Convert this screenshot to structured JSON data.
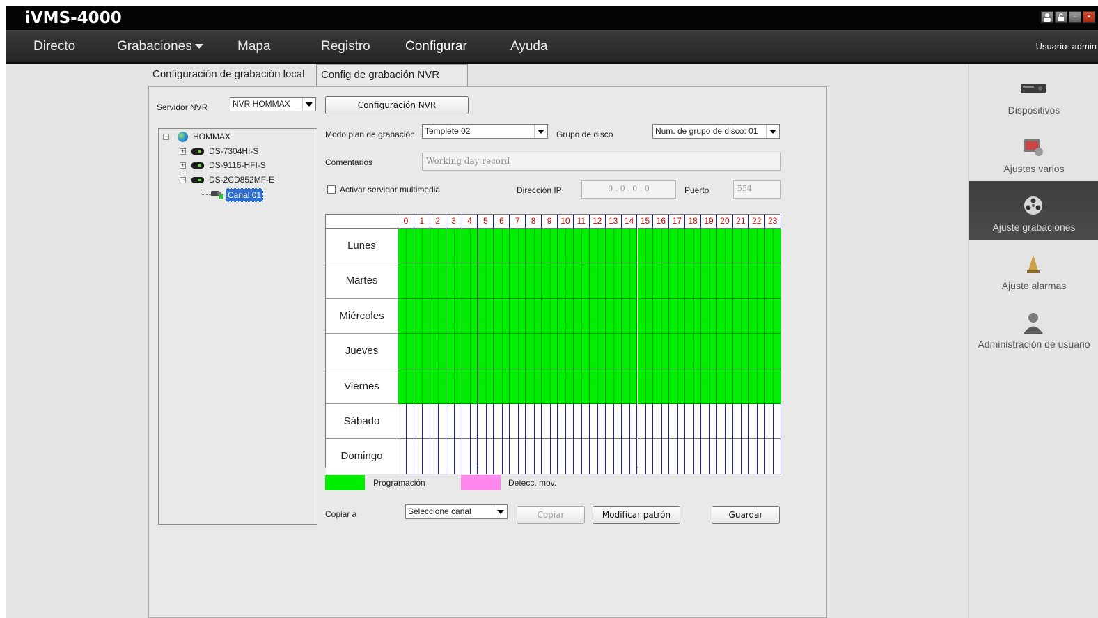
{
  "app": {
    "title": "iVMS-4000",
    "user_label": "Usuario: admin"
  },
  "menu": {
    "items": [
      {
        "label": "Directo"
      },
      {
        "label": "Grabaciones"
      },
      {
        "label": "Mapa"
      },
      {
        "label": "Registro"
      },
      {
        "label": "Configurar"
      },
      {
        "label": "Ayuda"
      }
    ],
    "selected": "Configurar"
  },
  "tabs": {
    "local": "Configuración de grabación local",
    "nvr": "Config de grabación NVR"
  },
  "form": {
    "nvr_server_label": "Servidor NVR",
    "nvr_server_value": "NVR HOMMAX",
    "nvr_config_button": "Configuración NVR",
    "plan_mode_label": "Modo plan de grabación",
    "plan_mode_value": "Templete 02",
    "disk_group_label": "Grupo de disco",
    "disk_group_value": "Num. de grupo de disco: 01",
    "comments_label": "Comentarios",
    "comments_value": "Working day record",
    "media_server_label": "Activar servidor multimedia",
    "media_server_checked": false,
    "ip_label": "Dirección IP",
    "ip_value": "0 . 0 . 0 . 0",
    "port_label": "Puerto",
    "port_value": "554"
  },
  "tree": {
    "root": "HOMMAX",
    "devices": [
      {
        "name": "DS-7304HI-S",
        "expanded": false
      },
      {
        "name": "DS-9116-HFI-S",
        "expanded": false
      },
      {
        "name": "DS-2CD852MF-E",
        "expanded": true
      }
    ],
    "channel": "Canal 01",
    "expand_plus": "+",
    "expand_minus": "−"
  },
  "schedule": {
    "hours": [
      "0",
      "1",
      "2",
      "3",
      "4",
      "5",
      "6",
      "7",
      "8",
      "9",
      "10",
      "11",
      "12",
      "13",
      "14",
      "15",
      "16",
      "17",
      "18",
      "19",
      "20",
      "21",
      "22",
      "23"
    ],
    "days": [
      {
        "label": "Lunes",
        "scheduled": true
      },
      {
        "label": "Martes",
        "scheduled": true
      },
      {
        "label": "Miércoles",
        "scheduled": true
      },
      {
        "label": "Jueves",
        "scheduled": true
      },
      {
        "label": "Viernes",
        "scheduled": true
      },
      {
        "label": "Sábado",
        "scheduled": false
      },
      {
        "label": "Domingo",
        "scheduled": false
      }
    ],
    "colors": {
      "scheduled": "#00ee00",
      "motion": "#ff88ee",
      "hour_text": "#d40000",
      "grid_line": "#1b1bd6"
    }
  },
  "legend": {
    "schedule_label": "Programación",
    "motion_label": "Detecc. mov."
  },
  "bottom": {
    "copy_to_label": "Copiar a",
    "channel_select_value": "Seleccione canal",
    "copy_button": "Copiar",
    "modify_button": "Modificar patrón",
    "save_button": "Guardar"
  },
  "sidebar": {
    "items": [
      {
        "label": "Dispositivos",
        "icon": "devices-icon"
      },
      {
        "label": "Ajustes varios",
        "icon": "settings-icon"
      },
      {
        "label": "Ajuste grabaciones",
        "icon": "recording-icon"
      },
      {
        "label": "Ajuste alarmas",
        "icon": "alarm-icon"
      },
      {
        "label": "Administración de usuario",
        "icon": "user-icon"
      }
    ],
    "active": "Ajuste grabaciones"
  },
  "window_buttons": {
    "minimize": "–",
    "close": "×"
  }
}
